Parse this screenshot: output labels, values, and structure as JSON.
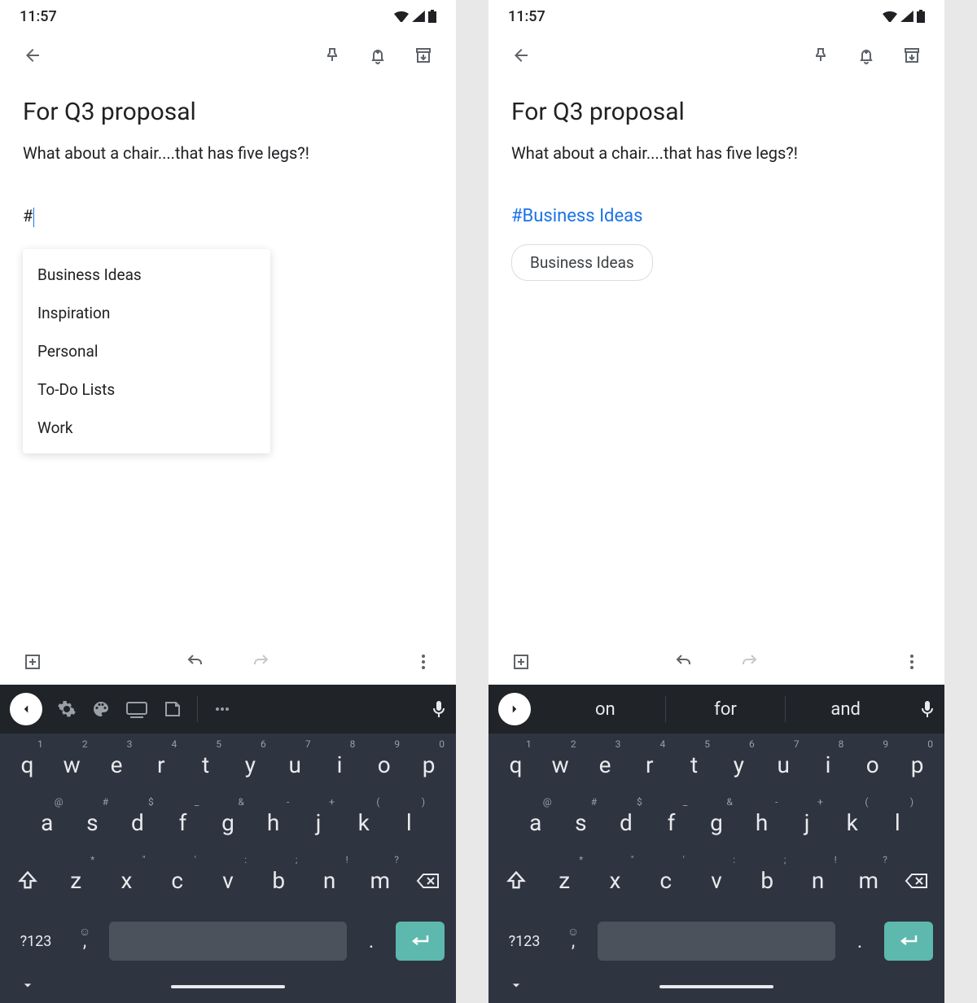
{
  "status": {
    "time": "11:57"
  },
  "note": {
    "title": "For Q3 proposal",
    "body": "What about a chair....that has five legs?!",
    "hash_input": "#",
    "hashtag": "#Business Ideas",
    "label_chip": "Business Ideas"
  },
  "autocomplete": [
    "Business Ideas",
    "Inspiration",
    "Personal",
    "To-Do Lists",
    "Work"
  ],
  "keyboard": {
    "row1": [
      {
        "k": "q",
        "s": "1"
      },
      {
        "k": "w",
        "s": "2"
      },
      {
        "k": "e",
        "s": "3"
      },
      {
        "k": "r",
        "s": "4"
      },
      {
        "k": "t",
        "s": "5"
      },
      {
        "k": "y",
        "s": "6"
      },
      {
        "k": "u",
        "s": "7"
      },
      {
        "k": "i",
        "s": "8"
      },
      {
        "k": "o",
        "s": "9"
      },
      {
        "k": "p",
        "s": "0"
      }
    ],
    "row2": [
      {
        "k": "a",
        "s": "@"
      },
      {
        "k": "s",
        "s": "#"
      },
      {
        "k": "d",
        "s": "$"
      },
      {
        "k": "f",
        "s": "_"
      },
      {
        "k": "g",
        "s": "&"
      },
      {
        "k": "h",
        "s": "-"
      },
      {
        "k": "j",
        "s": "+"
      },
      {
        "k": "k",
        "s": "("
      },
      {
        "k": "l",
        "s": ")"
      }
    ],
    "row3": [
      {
        "k": "z",
        "s": "*"
      },
      {
        "k": "x",
        "s": "\""
      },
      {
        "k": "c",
        "s": "'"
      },
      {
        "k": "v",
        "s": ":"
      },
      {
        "k": "b",
        "s": ";"
      },
      {
        "k": "n",
        "s": "!"
      },
      {
        "k": "m",
        "s": "?"
      }
    ],
    "sym_key": "?123",
    "suggestions": [
      "on",
      "for",
      "and"
    ]
  }
}
